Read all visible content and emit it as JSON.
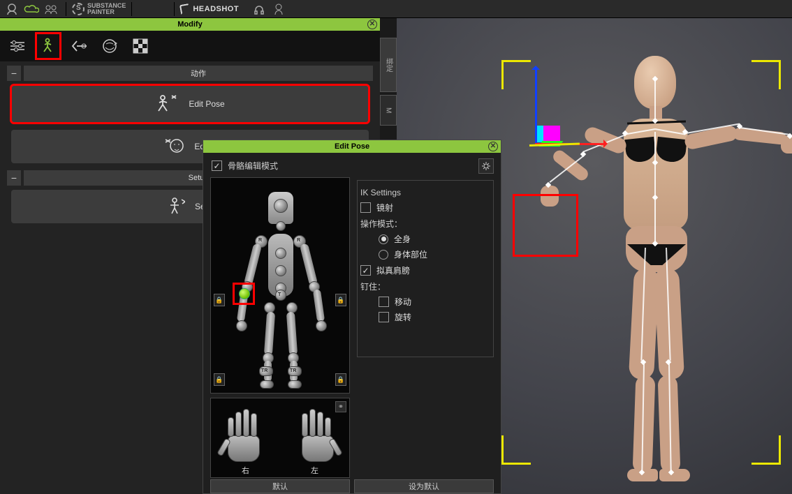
{
  "toolbar": {
    "substance_label": "SUBSTANCE\nPAINTER",
    "headshot_label": "HEADSHOT"
  },
  "modify_panel": {
    "title": "Modify",
    "section_motion": "动作",
    "edit_pose_btn": "Edit Pose",
    "edit_face_btn": "Edit F",
    "section_setup": "Setup",
    "set_hik_btn": "Set H",
    "side_tab1": "绑定",
    "side_tab2": "M"
  },
  "edit_pose": {
    "title": "Edit Pose",
    "skeleton_mode": "骨骼编辑模式",
    "ik_settings": "IK Settings",
    "mirror": "镜射",
    "op_mode": "操作模式：",
    "op_full_body": "全身",
    "op_body_part": "身体部位",
    "realistic_shoulder": "拟真肩膀",
    "pin": "钉住：",
    "pin_move": "移动",
    "pin_rotate": "旋转",
    "hand_right": "右",
    "hand_left": "左",
    "bottom_default": "默认",
    "bottom_set_default": "设为默认"
  },
  "highlight_color": "#ff0000"
}
